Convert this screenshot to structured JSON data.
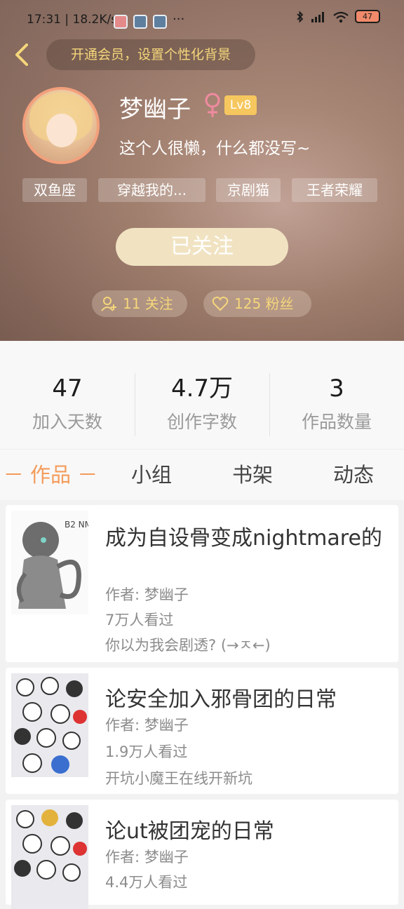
{
  "status_bar": {
    "time": "17:31 | 18.2K/s",
    "more": "···",
    "battery": "47"
  },
  "header": {
    "vip_banner": "开通会员，设置个性化背景",
    "username": "梦幽子",
    "gender_symbol": "♀",
    "level": "Lv8",
    "bio": "这个人很懒，什么都没写~",
    "tags": [
      "双鱼座",
      "穿越我的...",
      "京剧猫",
      "王者荣耀"
    ],
    "follow_button": "已关注",
    "following": "11 关注",
    "fans": "125 粉丝"
  },
  "stats": [
    {
      "value": "47",
      "label": "加入天数"
    },
    {
      "value": "4.7万",
      "label": "创作字数"
    },
    {
      "value": "3",
      "label": "作品数量"
    }
  ],
  "tabs": [
    "－ 作品 －",
    "小组",
    "书架",
    "动态"
  ],
  "works": [
    {
      "title": "成为自设骨变成nightmare的",
      "author": "作者: 梦幽子",
      "views": "7万人看过",
      "desc": "你以为我会剧透? (→ㅈ←)",
      "cover_text": "B2 NM"
    },
    {
      "title": "论安全加入邪骨团的日常",
      "author": "作者: 梦幽子",
      "views": "1.9万人看过",
      "desc": "开坑小魔王在线开新坑"
    },
    {
      "title": "论ut被团宠的日常",
      "author": "作者: 梦幽子",
      "views": "4.4万人看过",
      "desc": ""
    }
  ],
  "colors": {
    "accent": "#f49b5a",
    "gold": "#f5d67b",
    "level_badge": "#f6c75e"
  }
}
